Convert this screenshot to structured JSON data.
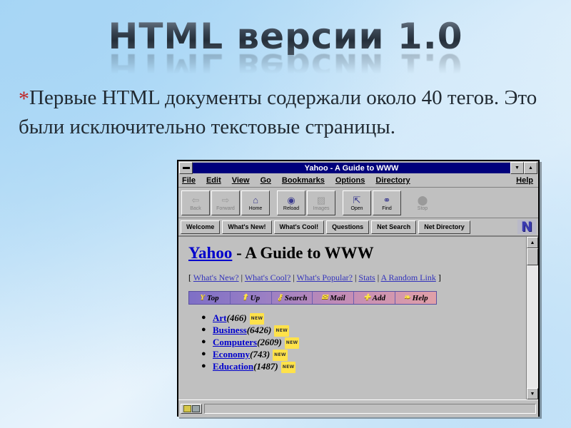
{
  "slide": {
    "title": "HTML версии 1.0",
    "bullet_marker": "*",
    "body": "Первые HTML документы содержали около 40 тегов. Это были исключительно текстовые страницы.",
    "background_top": "#9fd2f4",
    "background_bottom": "#cfe7f9",
    "marker_color": "#c02626"
  },
  "browser": {
    "titlebar": {
      "caption": "Yahoo - A Guide to WWW",
      "minimize_glyph": "▼",
      "maximize_glyph": "▲",
      "title_bg": "#00007b"
    },
    "menu": [
      {
        "label": "File"
      },
      {
        "label": "Edit"
      },
      {
        "label": "View"
      },
      {
        "label": "Go"
      },
      {
        "label": "Bookmarks"
      },
      {
        "label": "Options"
      },
      {
        "label": "Directory"
      }
    ],
    "menu_right": {
      "label": "Help"
    },
    "toolbar": [
      {
        "label": "Back",
        "icon": "back-arrow-icon",
        "glyph": "⇦",
        "enabled": false
      },
      {
        "label": "Forward",
        "icon": "forward-arrow-icon",
        "glyph": "⇨",
        "enabled": false
      },
      {
        "label": "Home",
        "icon": "home-icon",
        "glyph": "⌂",
        "enabled": true
      },
      {
        "label": "Reload",
        "icon": "reload-icon",
        "glyph": "◉",
        "enabled": true
      },
      {
        "label": "Images",
        "icon": "images-icon",
        "glyph": "▨",
        "enabled": false
      },
      {
        "label": "Open",
        "icon": "open-icon",
        "glyph": "⇱",
        "enabled": true
      },
      {
        "label": "Find",
        "icon": "find-binoculars-icon",
        "glyph": "⚭",
        "enabled": true
      },
      {
        "label": "Stop",
        "icon": "stop-icon",
        "glyph": "⬤",
        "enabled": false
      }
    ],
    "directory_buttons": [
      {
        "label": "Welcome"
      },
      {
        "label": "What's New!"
      },
      {
        "label": "What's Cool!"
      },
      {
        "label": "Questions"
      },
      {
        "label": "Net Search"
      },
      {
        "label": "Net Directory"
      }
    ],
    "logo": {
      "text": "N",
      "color": "#3b3bb0"
    },
    "page": {
      "heading_link": "Yahoo",
      "heading_rest": " - A Guide to WWW",
      "link_bar_open": "[",
      "link_bar_close": "]",
      "link_bar": [
        {
          "label": "What's New?"
        },
        {
          "label": "What's Cool?"
        },
        {
          "label": "What's Popular?"
        },
        {
          "label": "Stats"
        },
        {
          "label": "A Random Link"
        }
      ],
      "nav_buttons": [
        {
          "label": "Top",
          "icon": "yahoo-y-icon",
          "glyph": "Y"
        },
        {
          "label": "Up",
          "icon": "up-arrow-icon",
          "glyph": "⬆"
        },
        {
          "label": "Search",
          "icon": "search-key-icon",
          "glyph": "⚷"
        },
        {
          "label": "Mail",
          "icon": "mail-envelope-icon",
          "glyph": "✉"
        },
        {
          "label": "Add",
          "icon": "add-plus-icon",
          "glyph": "✚"
        },
        {
          "label": "Help",
          "icon": "help-icon",
          "glyph": "❧"
        }
      ],
      "categories": [
        {
          "name": "Art",
          "count": "(466)",
          "badge": "NEW"
        },
        {
          "name": "Business",
          "count": "(6426)",
          "badge": "NEW"
        },
        {
          "name": "Computers",
          "count": "(2609)",
          "badge": "NEW"
        },
        {
          "name": "Economy",
          "count": "(743)",
          "badge": "NEW"
        },
        {
          "name": "Education",
          "count": "(1487)",
          "badge": "NEW"
        }
      ],
      "background": "#c0c0c0",
      "link_color": "#0000cc"
    },
    "scrollbar": {
      "up_glyph": "▲",
      "down_glyph": "▼"
    }
  }
}
